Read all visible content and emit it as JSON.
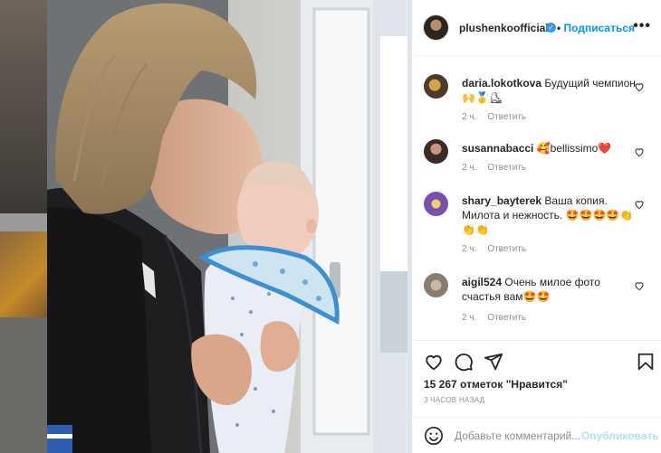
{
  "post": {
    "username": "plushenkoofficial",
    "follow_label": "Подписаться",
    "more_label": "•••"
  },
  "comments": [
    {
      "user": "daria.lokotkova",
      "text": "Будущий чемпион 🙌🥇⛸",
      "time": "2 ч.",
      "reply": "Ответить"
    },
    {
      "user": "susannabacci",
      "text": "🥰bellissimo❤️",
      "time": "2 ч.",
      "reply": "Ответить"
    },
    {
      "user": "shary_bayterek",
      "text": "Ваша копия. Милота и нежность. 🤩🤩🤩🤩👏👏👏",
      "time": "2 ч.",
      "reply": "Ответить"
    },
    {
      "user": "aigil524",
      "text": "Очень милое фото счастья вам🤩🤩",
      "time": "2 ч.",
      "reply": "Ответить"
    }
  ],
  "actions": {
    "likes": "15 267 отметок \"Нравится\"",
    "posted_ago": "3 ЧАСОВ НАЗАД"
  },
  "composer": {
    "placeholder": "Добавьте комментарий...",
    "publish_label": "Опубликовать"
  },
  "icons": [
    "heart-icon",
    "comment-icon",
    "share-icon",
    "bookmark-icon",
    "smile-icon",
    "verified-icon",
    "more-icon"
  ],
  "colors": {
    "accent": "#0095f6",
    "text": "#262626",
    "muted": "#8e8e8e",
    "border": "#efefef"
  }
}
